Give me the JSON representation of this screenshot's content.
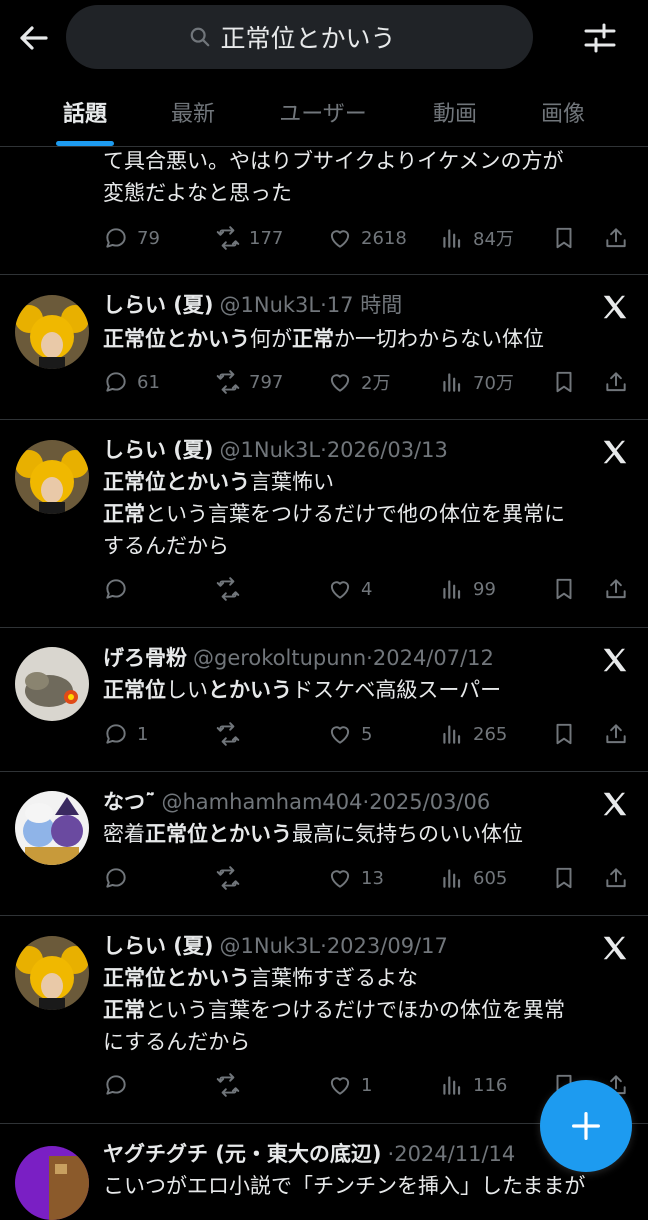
{
  "header": {
    "search_value": "正常位とかいう",
    "tabs": [
      "話題",
      "最新",
      "ユーザー",
      "動画",
      "画像"
    ]
  },
  "colors": {
    "accent": "#1d9bf0",
    "muted": "#71767b",
    "background": "#000000"
  },
  "posts": [
    {
      "body": [
        "て具合悪い。やはりブサイクよりイケメンの方が",
        "変態だよなと思った"
      ],
      "replies": "79",
      "reposts": "177",
      "likes": "2618",
      "views": "84万"
    },
    {
      "name": "しらい (夏)",
      "handle": "@1Nuk3L",
      "time": "17 時間",
      "body": [
        "正常位とかいう何が正常か一切わからない体位"
      ],
      "replies": "61",
      "reposts": "797",
      "likes": "2万",
      "views": "70万"
    },
    {
      "name": "しらい (夏)",
      "handle": "@1Nuk3L",
      "time": "2026/03/13",
      "body": [
        "正常位とかいう言葉怖い",
        "正常という言葉をつけるだけで他の体位を異常に",
        "するんだから"
      ],
      "replies": "",
      "reposts": "",
      "likes": "4",
      "views": "99"
    },
    {
      "name": "げろ骨粉",
      "handle": "@gerokoltupunn",
      "time": "2024/07/12",
      "body": [
        "正常位しいとかいうドスケベ高級スーパー"
      ],
      "replies": "1",
      "reposts": "",
      "likes": "5",
      "views": "265"
    },
    {
      "name": "なつ˜̈",
      "handle": "@hamhamham404",
      "time": "2025/03/06",
      "body": [
        "密着正常位とかいう最高に気持ちのいい体位"
      ],
      "replies": "",
      "reposts": "",
      "likes": "13",
      "views": "605"
    },
    {
      "name": "しらい (夏)",
      "handle": "@1Nuk3L",
      "time": "2023/09/17",
      "body": [
        "正常位とかいう言葉怖すぎるよな",
        "正常という言葉をつけるだけでほかの体位を異常",
        "にするんだから"
      ],
      "replies": "",
      "reposts": "",
      "likes": "1",
      "views": "116"
    },
    {
      "name": "ヤグチグチ (元・東大の底辺)",
      "handle": "",
      "time": "2024/11/14",
      "body": [
        "こいつがエロ小説で「チンチンを挿入」したままが"
      ]
    }
  ]
}
